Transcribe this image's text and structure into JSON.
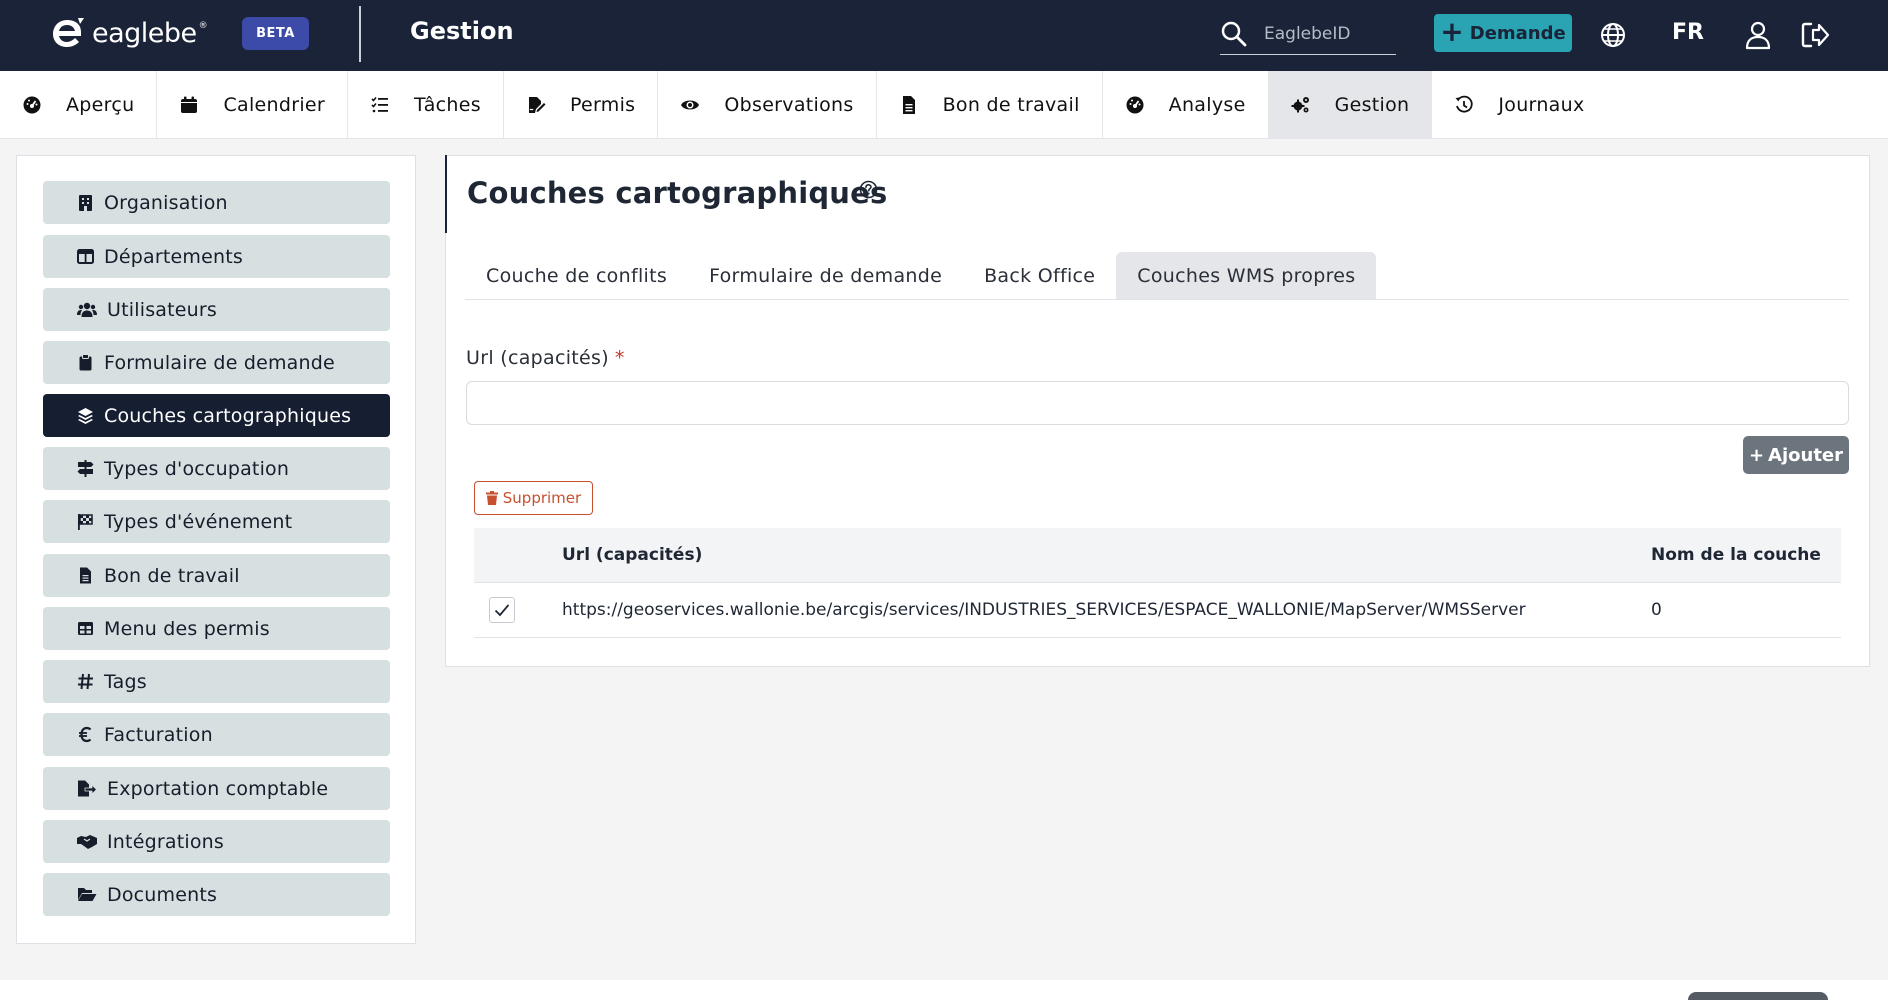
{
  "header": {
    "logo_text": "eaglebe",
    "beta": "BETA",
    "title": "Gestion",
    "search_placeholder": "EaglebeID",
    "demande_label": "Demande",
    "lang": "FR"
  },
  "nav": {
    "tabs": [
      {
        "label": "Aperçu",
        "icon": "gauge-icon"
      },
      {
        "label": "Calendrier",
        "icon": "calendar-icon"
      },
      {
        "label": "Tâches",
        "icon": "checklist-icon"
      },
      {
        "label": "Permis",
        "icon": "file-signature-icon"
      },
      {
        "label": "Observations",
        "icon": "eye-icon"
      },
      {
        "label": "Bon de travail",
        "icon": "file-icon"
      },
      {
        "label": "Analyse",
        "icon": "gauge-icon"
      },
      {
        "label": "Gestion",
        "icon": "cogs-icon",
        "active": true
      },
      {
        "label": "Journaux",
        "icon": "history-icon"
      }
    ]
  },
  "sidebar": {
    "items": [
      {
        "label": "Organisation",
        "icon": "building-icon"
      },
      {
        "label": "Départements",
        "icon": "table-columns-icon"
      },
      {
        "label": "Utilisateurs",
        "icon": "users-icon"
      },
      {
        "label": "Formulaire de demande",
        "icon": "clipboard-icon"
      },
      {
        "label": "Couches cartographiques",
        "icon": "layers-icon",
        "active": true
      },
      {
        "label": "Types d'occupation",
        "icon": "signs-post-icon"
      },
      {
        "label": "Types d'événement",
        "icon": "flag-checkered-icon"
      },
      {
        "label": "Bon de travail",
        "icon": "file-icon"
      },
      {
        "label": "Menu des permis",
        "icon": "table-icon"
      },
      {
        "label": "Tags",
        "icon": "hashtag-icon"
      },
      {
        "label": "Facturation",
        "icon": "euro-icon"
      },
      {
        "label": "Exportation comptable",
        "icon": "file-export-icon"
      },
      {
        "label": "Intégrations",
        "icon": "handshake-icon"
      },
      {
        "label": "Documents",
        "icon": "folder-open-icon"
      }
    ]
  },
  "main": {
    "title": "Couches cartographiques",
    "subtabs": [
      "Couche de conflits",
      "Formulaire de demande",
      "Back Office",
      "Couches WMS propres"
    ],
    "active_subtab": 3,
    "field_label": "Url (capacités)",
    "required_mark": "*",
    "url_value": "",
    "add_label": "Ajouter",
    "delete_label": "Supprimer",
    "table": {
      "headers": [
        "",
        "Url (capacités)",
        "Nom de la couche"
      ],
      "rows": [
        {
          "checked": true,
          "url": "https://geoservices.wallonie.be/arcgis/services/INDUSTRIES_SERVICES/ESPACE_WALLONIE/MapServer/WMSServer",
          "name": "0"
        }
      ]
    }
  },
  "colors": {
    "header_bg": "#1a2337",
    "accent": "#2aa3b3",
    "beta_bg": "#3c4aa8",
    "sidebar_item_bg": "#d6e0e0",
    "sidebar_active_bg": "#161e31",
    "danger": "#c6502f"
  }
}
